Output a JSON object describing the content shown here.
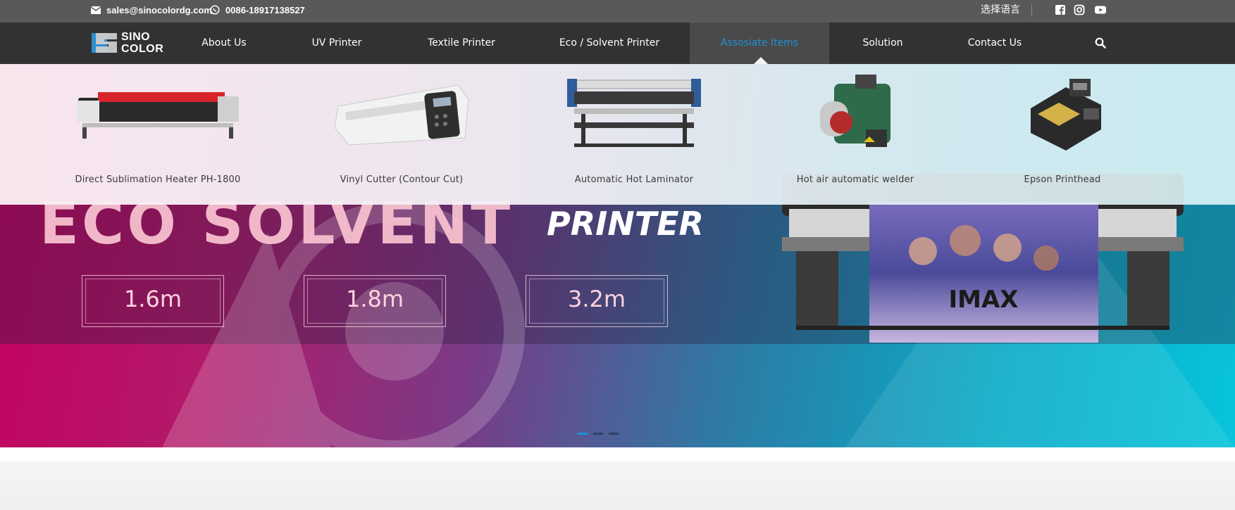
{
  "topbar": {
    "email": "sales@sinocolordg.com",
    "phone": "0086-18917138527",
    "language": "选择语言",
    "social_icons": [
      "facebook-icon",
      "instagram-icon",
      "youtube-icon"
    ]
  },
  "logo": {
    "line1": "SINO",
    "line2": "COLOR"
  },
  "nav": {
    "items": [
      {
        "label": "About Us"
      },
      {
        "label": "UV Printer"
      },
      {
        "label": "Textile Printer"
      },
      {
        "label": "Eco / Solvent Printer"
      },
      {
        "label": "Assosiate Items",
        "active": true
      },
      {
        "label": "Solution"
      },
      {
        "label": "Contact Us"
      }
    ],
    "search_icon": "search-icon"
  },
  "dropdown": {
    "items": [
      {
        "label": "Direct Sublimation Heater PH-1800"
      },
      {
        "label": "Vinyl Cutter (Contour Cut)"
      },
      {
        "label": "Automatic Hot Laminator"
      },
      {
        "label": "Hot air automatic welder"
      },
      {
        "label": "Epson Printhead"
      }
    ]
  },
  "hero": {
    "headline": "ECO SOLVENT",
    "subheadline": "PRINTER",
    "sizes": [
      "1.6m",
      "1.8m",
      "3.2m"
    ],
    "banner_text": "IMAX",
    "slides": 3,
    "active_slide": 1
  },
  "colors": {
    "topbar": "#595959",
    "nav": "#323232",
    "accent": "#1e90d6"
  }
}
